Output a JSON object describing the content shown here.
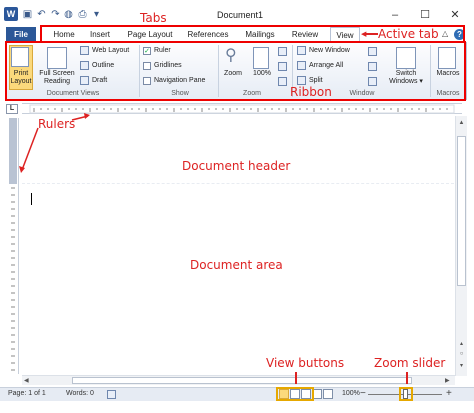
{
  "window": {
    "title": "Document1",
    "app_icon": "word-icon",
    "quick_access": [
      "save-icon",
      "undo-icon",
      "redo-icon",
      "print-preview-icon",
      "customize-icon"
    ],
    "controls": {
      "minimize": "–",
      "maximize": "☐",
      "close": "✕"
    }
  },
  "tabs": {
    "file": "File",
    "items": [
      "Home",
      "Insert",
      "Page Layout",
      "References",
      "Mailings",
      "Review",
      "View"
    ],
    "active": "View"
  },
  "ribbon": {
    "document_views": {
      "label": "Document Views",
      "print_layout": "Print\nLayout",
      "full_screen_reading": "Full Screen\nReading",
      "web_layout": "Web Layout",
      "outline": "Outline",
      "draft": "Draft"
    },
    "show": {
      "label": "Show",
      "ruler": "Ruler",
      "gridlines": "Gridlines",
      "navigation_pane": "Navigation Pane"
    },
    "zoom": {
      "label": "Zoom",
      "zoom": "Zoom",
      "hundred": "100%"
    },
    "window": {
      "label": "Window",
      "new_window": "New Window",
      "arrange_all": "Arrange All",
      "split": "Split",
      "switch_windows": "Switch\nWindows ▾"
    },
    "macros": {
      "label": "Macros",
      "macros": "Macros"
    }
  },
  "status": {
    "page": "Page: 1 of 1",
    "words": "Words: 0",
    "zoom_level": "100%",
    "zoom_minus": "−",
    "zoom_plus": "+",
    "zoom_fraction": 0.5
  },
  "annotations": {
    "tabs": "Tabs",
    "active_tab": "Active tab",
    "ribbon": "Ribbon",
    "rulers": "Rulers",
    "document_header": "Document header",
    "document_area": "Document area",
    "view_buttons": "View buttons",
    "zoom_slider": "Zoom slider"
  },
  "colors": {
    "file_tab": "#2b5797",
    "annotation": "#dd2222",
    "highlight_outline": "#e00000",
    "status_outline": "#e6a800"
  }
}
